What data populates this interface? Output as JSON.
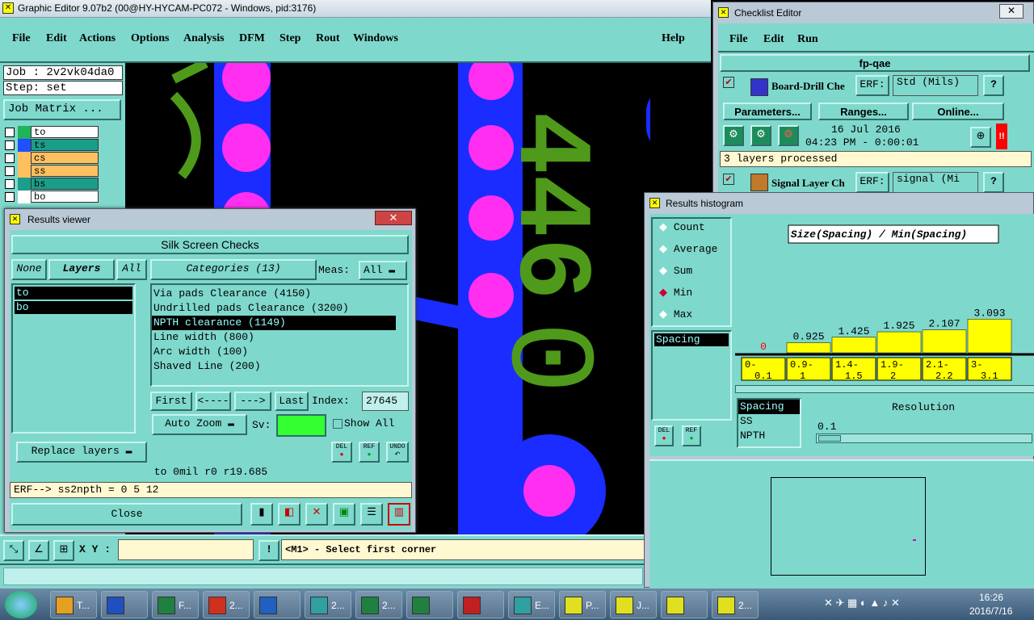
{
  "main_window": {
    "title": "Graphic Editor 9.07b2 (00@HY-HYCAM-PC072 - Windows, pid:3176)",
    "menu": [
      "File",
      "Edit",
      "Actions",
      "Options",
      "Analysis",
      "DFM",
      "Step",
      "Rout",
      "Windows"
    ],
    "help": "Help",
    "job": "Job : 2v2vk04da0",
    "step": "Step: set",
    "job_matrix": "Job Matrix ...",
    "layers": [
      {
        "name": "to",
        "color": "#1fb35a",
        "bg": "#ffffff"
      },
      {
        "name": "ts",
        "color": "#1f4fff",
        "bg": "#1a9e8a"
      },
      {
        "name": "cs",
        "color": "#ffc060",
        "bg": "#ffc060"
      },
      {
        "name": "ss",
        "color": "#ffc060",
        "bg": "#ffc060"
      },
      {
        "name": "bs",
        "color": "#1a9e8a",
        "bg": "#1a9e8a"
      },
      {
        "name": "bo",
        "color": "#ffffff",
        "bg": "#ffffff"
      }
    ],
    "xy_label": "X Y :",
    "status_hint": "<M1> - Select first corner"
  },
  "results_viewer": {
    "title": "Results viewer",
    "header": "Silk Screen Checks",
    "none": "None",
    "layers": "Layers",
    "all": "All",
    "categories": "Categories (13)",
    "meas_label": "Meas:",
    "meas_value": "All",
    "layer_items": [
      "to",
      "bo"
    ],
    "category_items": [
      "Via pads Clearance (4150)",
      "Undrilled pads Clearance (3200)",
      "NPTH clearance (1149)",
      "Line width (800)",
      "Arc width (100)",
      "Shaved Line (200)"
    ],
    "selected_category": 2,
    "first": "First",
    "prev": "<----",
    "next": "--->",
    "last": "Last",
    "index_label": "Index:",
    "index_value": "27645",
    "auto_zoom": "Auto Zoom",
    "sv_label": "Sv:",
    "show_all": "Show All",
    "replace_layers": "Replace layers",
    "del": "DEL",
    "ref": "REF",
    "undo": "UNDO",
    "info_line": "to 0mil  r0  r19.685",
    "erf_line": "ERF--> ss2npth = 0 5 12",
    "close": "Close"
  },
  "checklist_editor": {
    "title": "Checklist Editor",
    "menu": [
      "File",
      "Edit",
      "Run"
    ],
    "name": "fp-qae",
    "check1_label": "Board-Drill Che",
    "erf": "ERF:",
    "check1_erf": "Std (Mils)",
    "parameters": "Parameters...",
    "ranges": "Ranges...",
    "online": "Online...",
    "date": "16 Jul 2016",
    "time": "04:23 PM - 0:00:01",
    "status": "3 layers processed",
    "check2_label": "Signal Layer Ch",
    "check2_erf": "signal (Mi"
  },
  "histogram": {
    "title": "Results histogram",
    "options": [
      "Count",
      "Average",
      "Sum",
      "Min",
      "Max"
    ],
    "selected_option": "Min",
    "chart_title": "Size(Spacing) / Min(Spacing)",
    "meas_items": [
      "Spacing"
    ],
    "sub_items": [
      "Spacing",
      "SS",
      "NPTH"
    ],
    "resolution_label": "Resolution",
    "resolution_value": "0.1",
    "del": "DEL",
    "ref": "REF"
  },
  "chart_data": {
    "type": "bar",
    "title": "Size(Spacing) / Min(Spacing)",
    "categories": [
      "0-0.1",
      "0.9-1",
      "1.4-1.5",
      "1.9-2",
      "2.1-2.2",
      "3-3.1"
    ],
    "values": [
      0,
      0.925,
      1.425,
      1.925,
      2.107,
      3.093
    ],
    "labels": [
      "0",
      "0.925",
      "1.425",
      "1.925",
      "2.107",
      "3.093"
    ],
    "ylim": [
      0,
      3.1
    ],
    "grid": false,
    "colors": {
      "bar": "#ffff00",
      "zero_label": "#ff0000"
    }
  },
  "taskbar": {
    "items": [
      "T...",
      "",
      "F...",
      "2...",
      "",
      "2...",
      "2...",
      "",
      "",
      "E...",
      "P...",
      "J...",
      "",
      "2..."
    ],
    "time": "16:26",
    "date": "2016/7/16"
  }
}
